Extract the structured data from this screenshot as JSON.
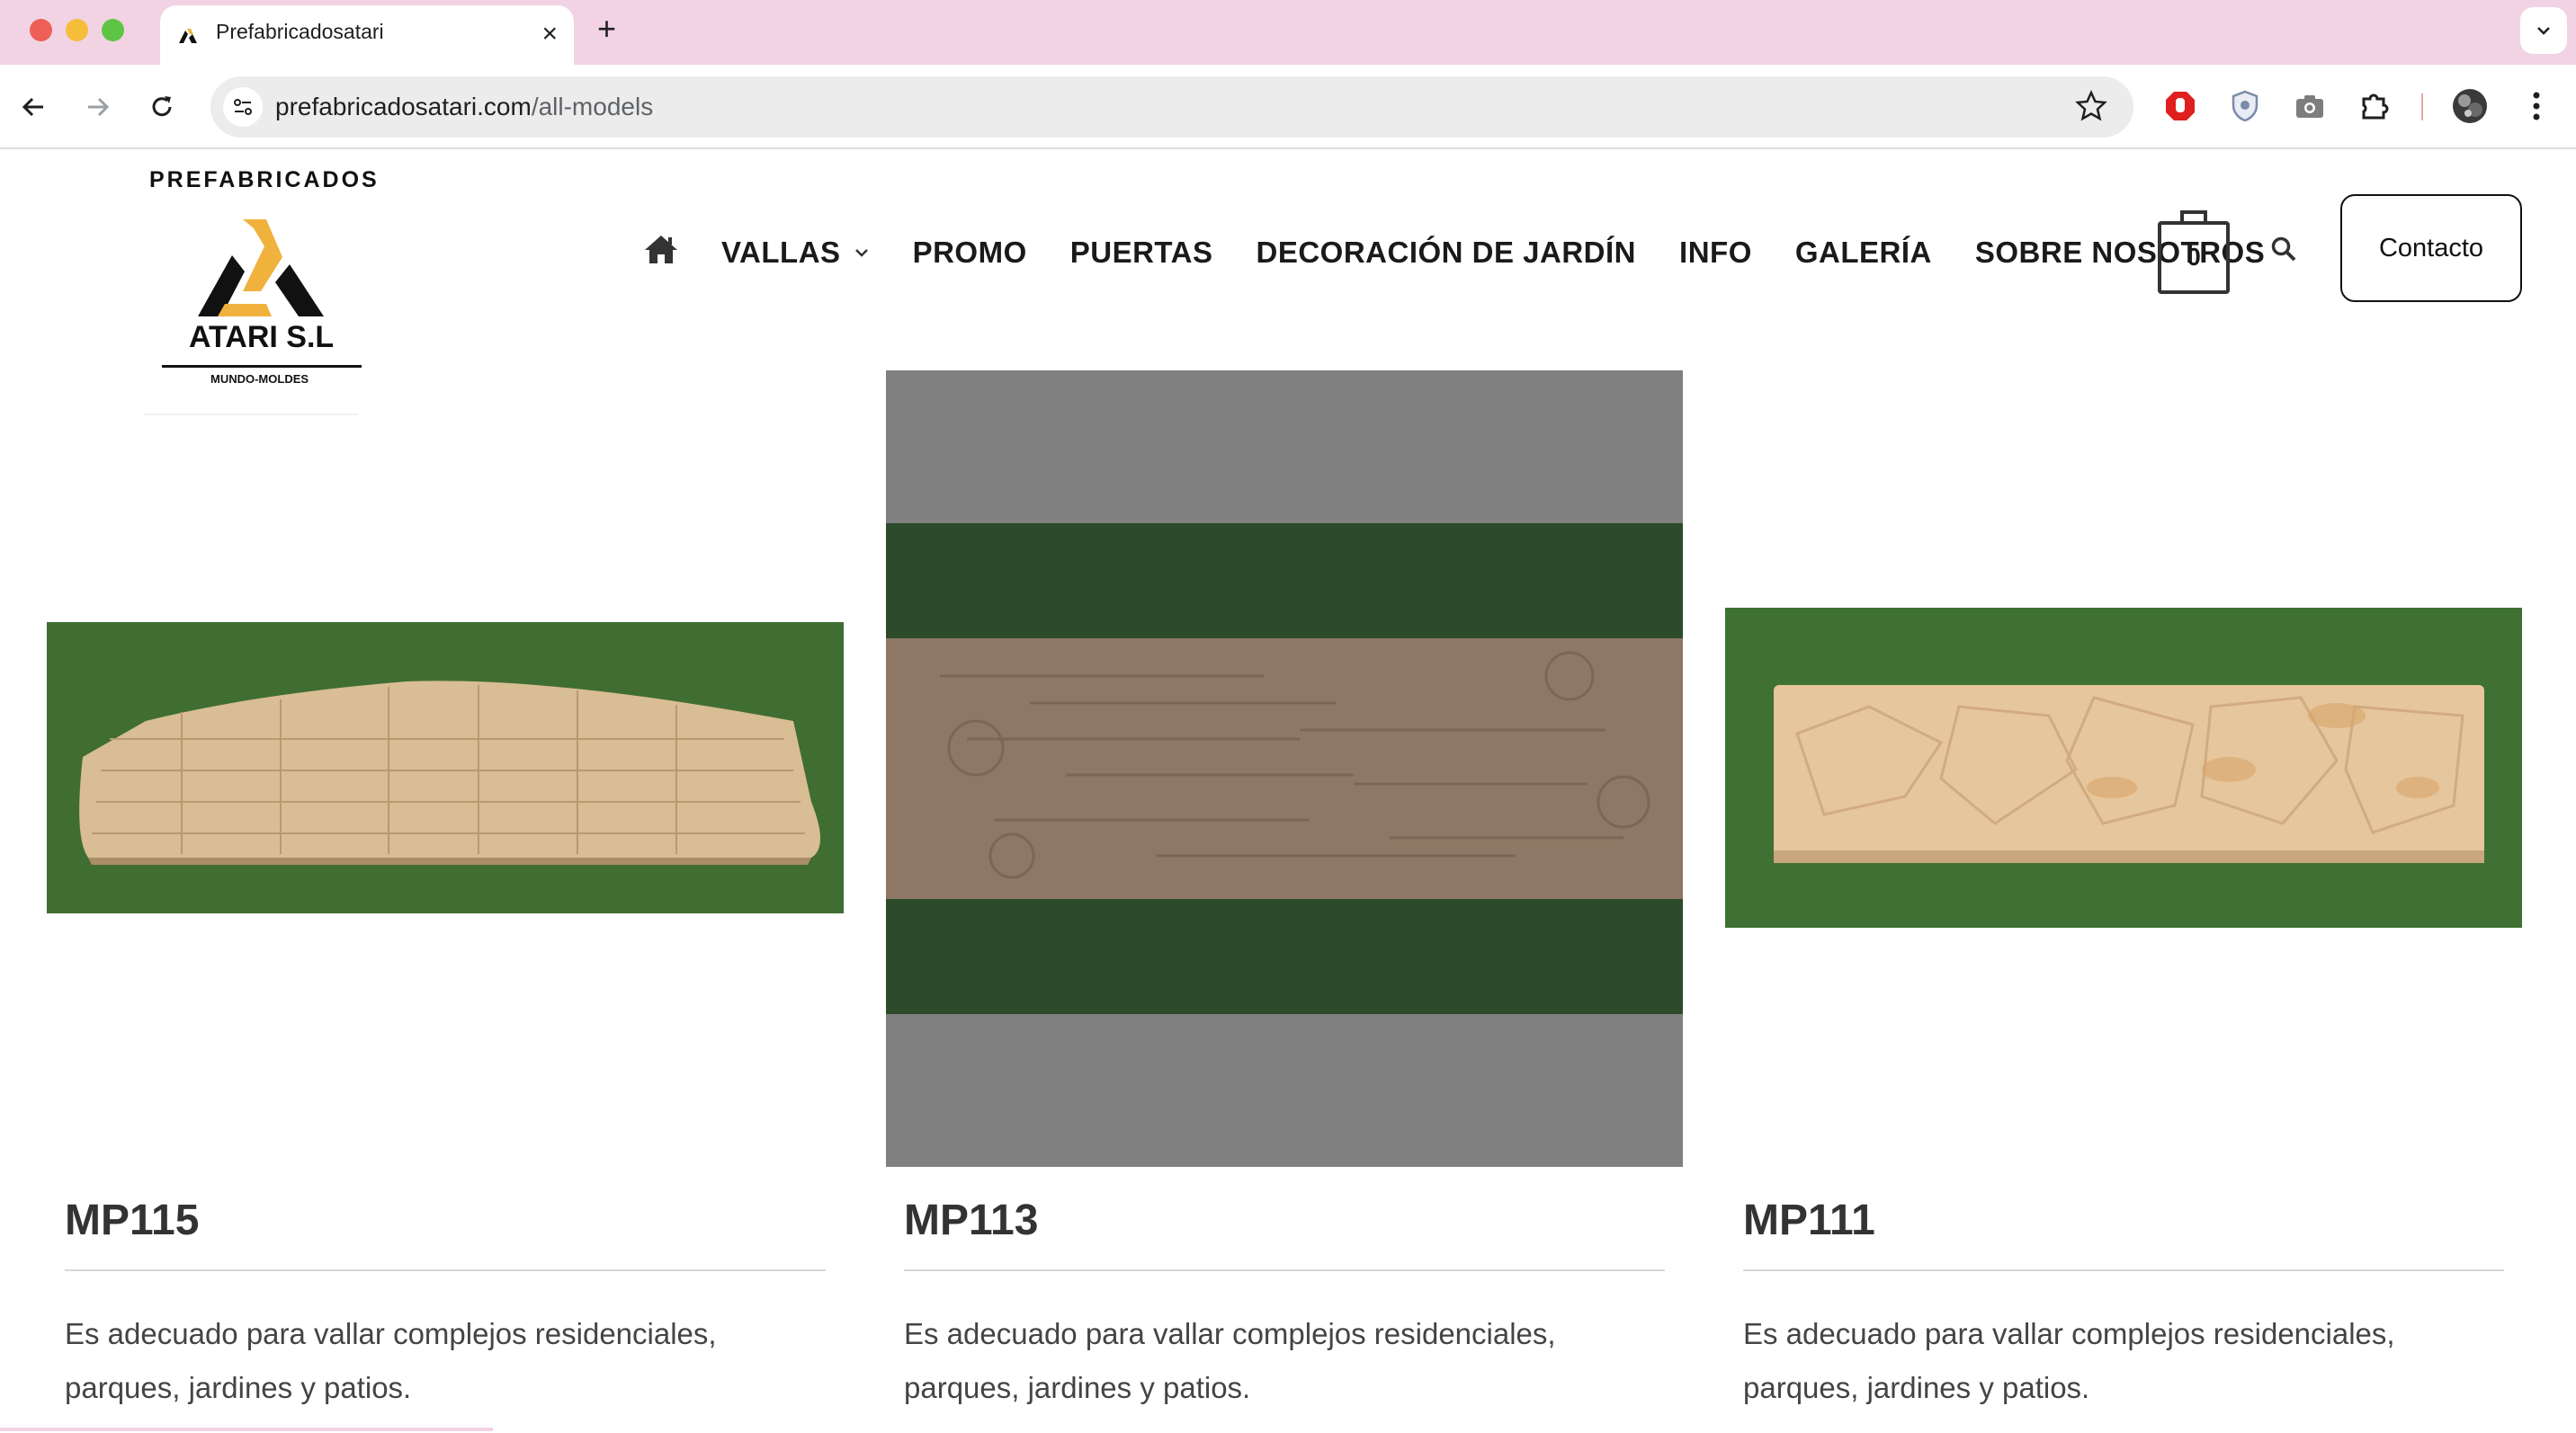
{
  "browser": {
    "tab_title": "Prefabricadosatari",
    "url_domain": "prefabricadosatari.com",
    "url_path": "/all-models"
  },
  "site": {
    "logo_top": "PREFABRICADOS",
    "logo_name": "ATARI S.L",
    "logo_sub": "MUNDO-MOLDES",
    "nav": [
      {
        "label": "VALLAS"
      },
      {
        "label": "PROMO"
      },
      {
        "label": "PUERTAS"
      },
      {
        "label": "DECORACIÓN DE JARDÍN"
      },
      {
        "label": "INFO"
      },
      {
        "label": "GALERÍA"
      },
      {
        "label": "SOBRE NOSOTROS"
      }
    ],
    "cart_count": "0",
    "contact_label": "Contacto",
    "accent_color": "#f0b23c"
  },
  "products": [
    {
      "name": "MP115",
      "description": "Es adecuado para vallar complejos residenciales, parques, jardines y patios."
    },
    {
      "name": "MP113",
      "description": "Es adecuado para vallar complejos residenciales, parques, jardines y patios."
    },
    {
      "name": "MP111",
      "description": "Es adecuado para vallar complejos residenciales, parques, jardines y patios."
    }
  ]
}
